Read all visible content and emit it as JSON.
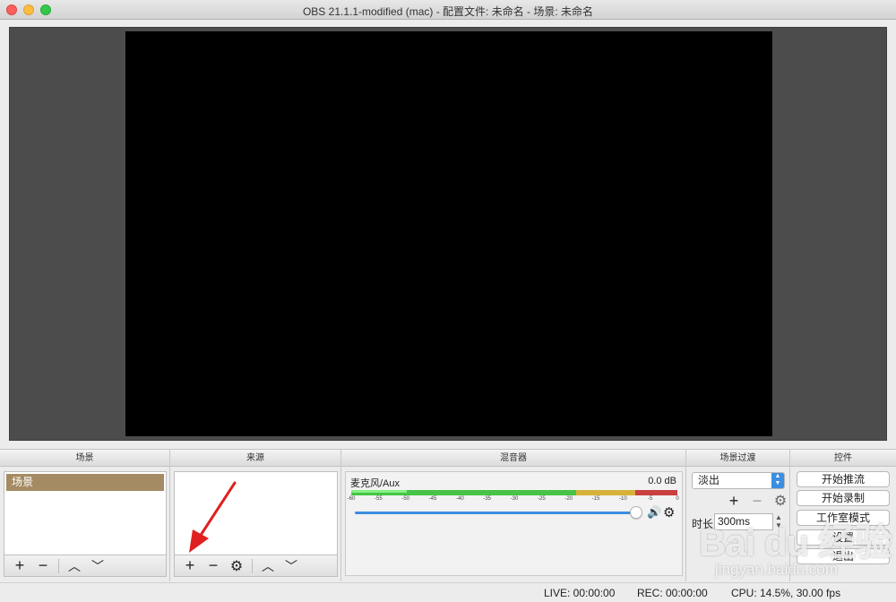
{
  "window": {
    "title": "OBS 21.1.1-modified (mac) - 配置文件: 未命名 - 场景: 未命名"
  },
  "docks": {
    "scenes": {
      "title": "场景",
      "items": [
        {
          "label": "场景",
          "selected": true
        }
      ]
    },
    "sources": {
      "title": "来源",
      "items": []
    },
    "mixer": {
      "title": "混音器",
      "channel": {
        "name": "麦克风/Aux",
        "level": "0.0 dB",
        "ticks": [
          "-60",
          "-55",
          "-50",
          "-45",
          "-40",
          "-35",
          "-30",
          "-25",
          "-20",
          "-15",
          "-10",
          "-5",
          "0"
        ]
      }
    },
    "transitions": {
      "title": "场景过渡",
      "selected": "淡出",
      "duration_label": "时长",
      "duration_value": "300ms"
    },
    "controls": {
      "title": "控件",
      "buttons": {
        "start_streaming": "开始推流",
        "start_recording": "开始录制",
        "studio_mode": "工作室模式",
        "settings": "设置",
        "exit": "退出"
      }
    }
  },
  "icons": {
    "plus": "+",
    "minus": "−",
    "up": "︿",
    "down": "﹀",
    "gear": "⚙",
    "volume": "🔊"
  },
  "status": {
    "live": "LIVE: 00:00:00",
    "rec": "REC: 00:00:00",
    "cpu": "CPU: 14.5%, 30.00 fps"
  },
  "watermark": {
    "logo": "Bai du 经验",
    "url": "jingyan.baidu.com"
  },
  "colors": {
    "scene_selected": "#a58b63",
    "accent_blue": "#3b8ee2",
    "meter_green": "#47c447",
    "meter_yellow": "#d6b338",
    "meter_red": "#c94040",
    "annotation_red": "#e02020"
  }
}
